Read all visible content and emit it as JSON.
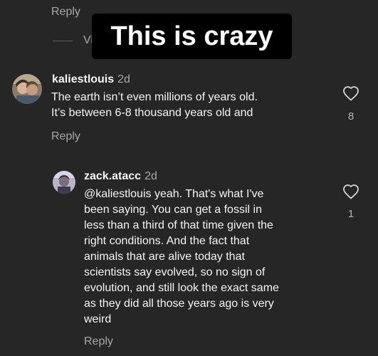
{
  "top_reply": {
    "label": "Reply"
  },
  "view_replies": {
    "text_fragment": "Vi"
  },
  "overlay_caption": {
    "text": "This is crazy"
  },
  "comments": [
    {
      "username": "kaliestlouis",
      "time": "2d",
      "lines": [
        "The earth isn’t even millions of years old.",
        "It’s between 6-8 thousand years old and"
      ],
      "likes": "8",
      "reply_label": "Reply",
      "avatar_icon": "profile-photo-icon"
    },
    {
      "username": "zack.atacc",
      "time": "2d",
      "lines": [
        "@kaliestlouis yeah. That's what I've",
        "been saying. You can get a fossil in",
        "less than a third of that time given the",
        "right conditions. And the fact that",
        "animals that are alive today that",
        "scientists say evolved, so no sign of",
        "evolution, and still look the exact same",
        "as they did all those years ago is very",
        "weird"
      ],
      "likes": "1",
      "reply_label": "Reply",
      "avatar_icon": "profile-photo-icon"
    }
  ],
  "icons": {
    "like": "heart-outline-icon"
  },
  "colors": {
    "background": "#262626",
    "primary_text": "#f5f5f5",
    "secondary_text": "#a8a8a8",
    "overlay_background": "#000000",
    "overlay_text": "#ffffff"
  }
}
